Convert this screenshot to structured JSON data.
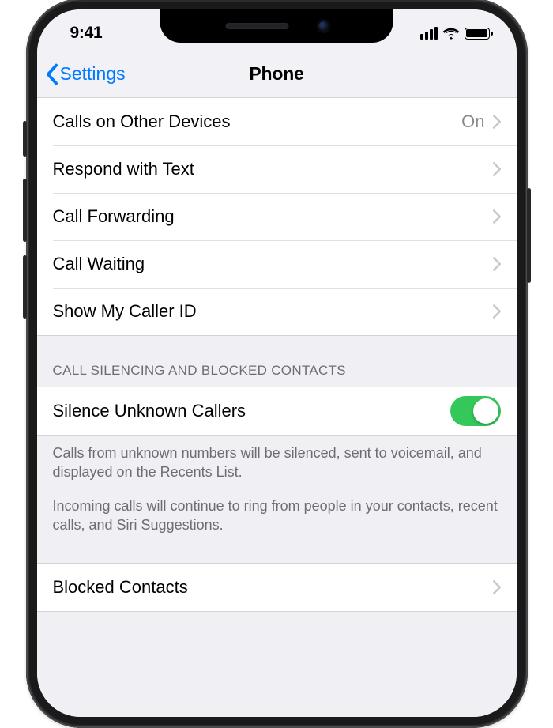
{
  "status": {
    "time": "9:41"
  },
  "nav": {
    "back_label": "Settings",
    "title": "Phone"
  },
  "calls_section": {
    "rows": [
      {
        "label": "Calls on Other Devices",
        "value": "On"
      },
      {
        "label": "Respond with Text"
      },
      {
        "label": "Call Forwarding"
      },
      {
        "label": "Call Waiting"
      },
      {
        "label": "Show My Caller ID"
      }
    ]
  },
  "silencing_section": {
    "header": "CALL SILENCING AND BLOCKED CONTACTS",
    "toggle": {
      "label": "Silence Unknown Callers",
      "value": true
    },
    "footer1": "Calls from unknown numbers will be silenced, sent to voicemail, and displayed on the Recents List.",
    "footer2": "Incoming calls will continue to ring from people in your contacts, recent calls, and Siri Suggestions."
  },
  "blocked_section": {
    "rows": [
      {
        "label": "Blocked Contacts"
      }
    ]
  },
  "colors": {
    "link": "#007aff",
    "switch_on": "#34c759",
    "separator": "rgba(0,0,0,0.12)",
    "secondary_text": "#8a8a8e",
    "group_bg": "#efeff4"
  }
}
